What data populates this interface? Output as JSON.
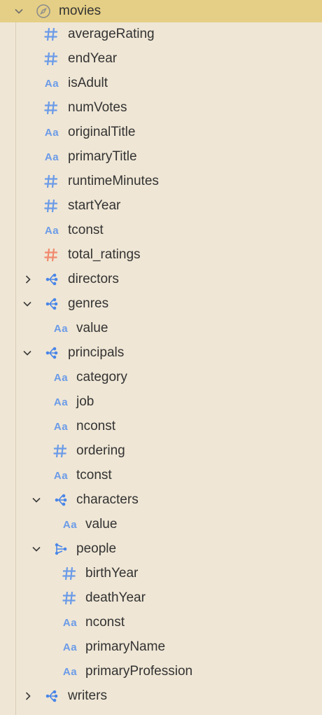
{
  "root": {
    "label": "movies",
    "icon": "compass-icon",
    "expanded": true
  },
  "colors": {
    "header_bg": "#e5cf86",
    "panel_bg": "#efe6d5",
    "field_blue": "#6b9be8",
    "field_orange": "#f08a6e",
    "tree_blue": "#4a86e8"
  },
  "fields": [
    {
      "label": "averageRating",
      "type": "number"
    },
    {
      "label": "endYear",
      "type": "number"
    },
    {
      "label": "isAdult",
      "type": "string"
    },
    {
      "label": "numVotes",
      "type": "number"
    },
    {
      "label": "originalTitle",
      "type": "string"
    },
    {
      "label": "primaryTitle",
      "type": "string"
    },
    {
      "label": "runtimeMinutes",
      "type": "number"
    },
    {
      "label": "startYear",
      "type": "number"
    },
    {
      "label": "tconst",
      "type": "string"
    },
    {
      "label": "total_ratings",
      "type": "number-calculated"
    }
  ],
  "relations": {
    "directors": {
      "label": "directors",
      "expanded": false
    },
    "genres": {
      "label": "genres",
      "expanded": true,
      "fields": [
        {
          "label": "value",
          "type": "string"
        }
      ]
    },
    "principals": {
      "label": "principals",
      "expanded": true,
      "fields": [
        {
          "label": "category",
          "type": "string"
        },
        {
          "label": "job",
          "type": "string"
        },
        {
          "label": "nconst",
          "type": "string"
        },
        {
          "label": "ordering",
          "type": "number"
        },
        {
          "label": "tconst",
          "type": "string"
        }
      ],
      "characters": {
        "label": "characters",
        "expanded": true,
        "fields": [
          {
            "label": "value",
            "type": "string"
          }
        ]
      },
      "people": {
        "label": "people",
        "expanded": true,
        "fields": [
          {
            "label": "birthYear",
            "type": "number"
          },
          {
            "label": "deathYear",
            "type": "number"
          },
          {
            "label": "nconst",
            "type": "string"
          },
          {
            "label": "primaryName",
            "type": "string"
          },
          {
            "label": "primaryProfession",
            "type": "string"
          }
        ]
      }
    },
    "writers": {
      "label": "writers",
      "expanded": false
    }
  }
}
